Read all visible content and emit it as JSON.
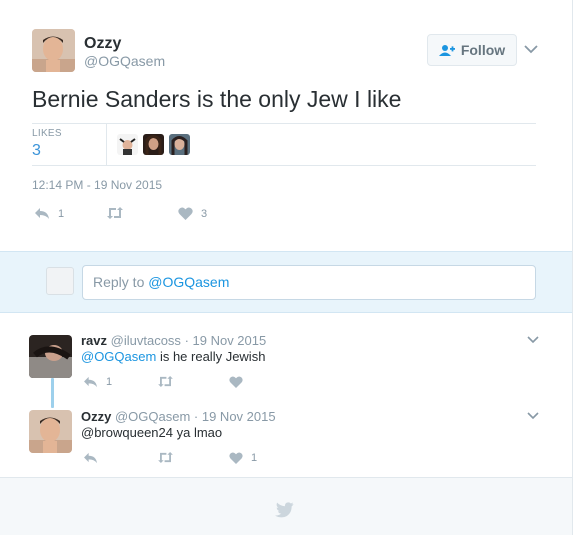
{
  "tweet": {
    "author_name": "Ozzy",
    "author_handle": "@OGQasem",
    "text": "Bernie Sanders is the only Jew I like",
    "likes_label": "LIKES",
    "likes_count": "3",
    "timestamp": "12:14 PM - 19 Nov 2015",
    "reply_count": "1",
    "like_count": "3"
  },
  "follow_button": {
    "label": "Follow",
    "icon": "add-user-icon"
  },
  "reply_box": {
    "prefix": "Reply to ",
    "mention": "@OGQasem"
  },
  "replies": [
    {
      "name": "ravz",
      "handle": "@iluvtacoss",
      "date": "· 19 Nov 2015",
      "mention": "@OGQasem",
      "text": " is he really Jewish",
      "reply_count": "1",
      "like_count": ""
    },
    {
      "name": "Ozzy",
      "handle": "@OGQasem",
      "date": "· 19 Nov 2015",
      "mention": "",
      "text": "@browqueen24 ya lmao",
      "reply_count": "",
      "like_count": "1"
    }
  ],
  "colors": {
    "accent": "#1b95e0",
    "muted": "#8899a6",
    "text": "#292f33",
    "reply_bg": "#e8f4fb"
  }
}
